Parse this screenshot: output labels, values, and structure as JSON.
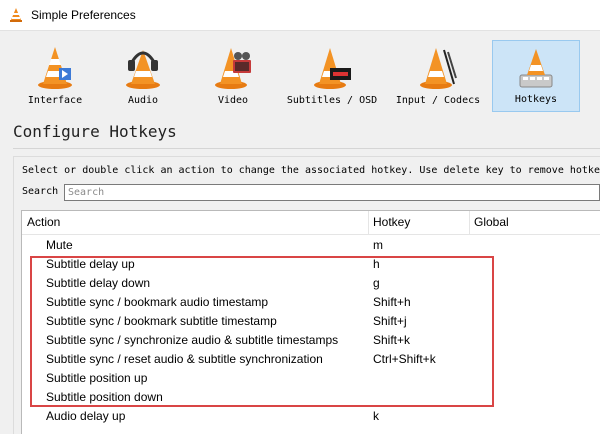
{
  "window": {
    "title": "Simple Preferences"
  },
  "categories": [
    {
      "label": "Interface",
      "icon": "vlc-cone-icon"
    },
    {
      "label": "Audio",
      "icon": "headphones-cone-icon"
    },
    {
      "label": "Video",
      "icon": "film-cone-icon"
    },
    {
      "label": "Subtitles / OSD",
      "icon": "subtitles-cone-icon"
    },
    {
      "label": "Input / Codecs",
      "icon": "input-codecs-cone-icon"
    },
    {
      "label": "Hotkeys",
      "icon": "hotkeys-cone-icon",
      "selected": true
    }
  ],
  "page_heading": "Configure Hotkeys",
  "instructions": "Select or double click an action to change the associated hotkey. Use delete key to remove hotkeys",
  "search": {
    "label": "Search",
    "placeholder": "Search",
    "value": ""
  },
  "table": {
    "columns": [
      "Action",
      "Hotkey",
      "Global"
    ],
    "rows": [
      {
        "action": "Mute",
        "hotkey": "m"
      },
      {
        "action": "Subtitle delay up",
        "hotkey": "h"
      },
      {
        "action": "Subtitle delay down",
        "hotkey": "g"
      },
      {
        "action": "Subtitle sync / bookmark audio timestamp",
        "hotkey": "Shift+h"
      },
      {
        "action": "Subtitle sync / bookmark subtitle timestamp",
        "hotkey": "Shift+j"
      },
      {
        "action": "Subtitle sync / synchronize audio & subtitle timestamps",
        "hotkey": "Shift+k"
      },
      {
        "action": "Subtitle sync / reset audio & subtitle synchronization",
        "hotkey": "Ctrl+Shift+k"
      },
      {
        "action": "Subtitle position up",
        "hotkey": ""
      },
      {
        "action": "Subtitle position down",
        "hotkey": ""
      },
      {
        "action": "Audio delay up",
        "hotkey": "k"
      }
    ]
  },
  "colors": {
    "accent": "#cce4f7",
    "cone_orange": "#f08a1e",
    "highlight_box": "#d94545"
  }
}
